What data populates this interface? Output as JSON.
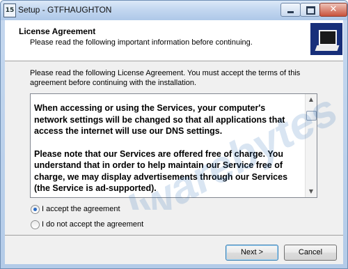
{
  "window": {
    "title": "Setup - GTFHAUGHTON",
    "app_icon_text": "15",
    "close_glyph": "✕"
  },
  "header": {
    "title": "License Agreement",
    "subtitle": "Please read the following important information before continuing."
  },
  "intro": "Please read the following License Agreement. You must accept the terms of this agreement before continuing with the installation.",
  "license": {
    "paragraphs": [
      "When accessing or using the Services, your computer's network settings will be changed so that all applications that access the internet will use our DNS settings.",
      "Please note that our Services are offered free of charge. You understand that in order to help maintain our Service free of charge, we may display advertisements through our Services (the Service is ad-supported)."
    ]
  },
  "options": {
    "accept": "I accept the agreement",
    "decline": "I do not accept the agreement",
    "selected": "accept"
  },
  "buttons": {
    "next": "Next >",
    "cancel": "Cancel"
  },
  "watermark": "Malwarebytes",
  "scrollbar": {
    "up_glyph": "▲",
    "down_glyph": "▼"
  }
}
